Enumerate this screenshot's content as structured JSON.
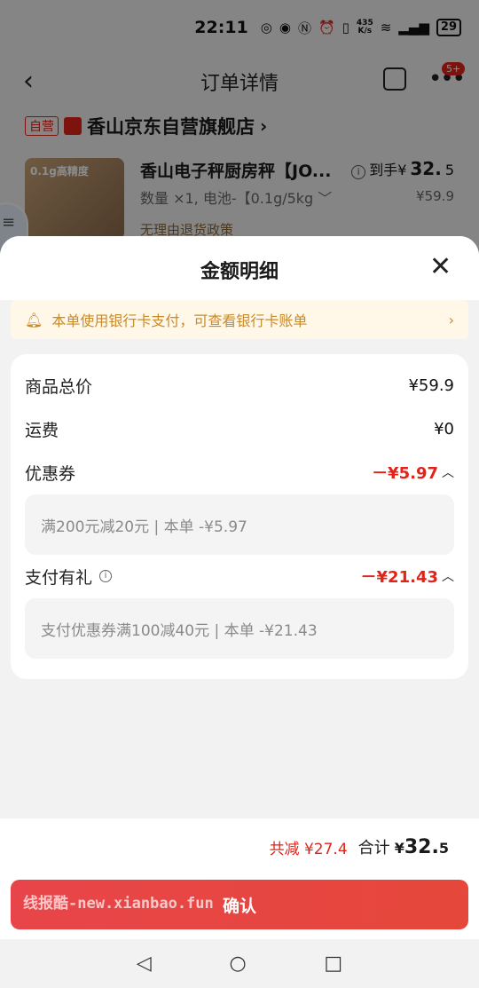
{
  "status_bar": {
    "time": "22:11",
    "net_speed_top": "435",
    "net_speed_bottom": "K/s",
    "battery": "29"
  },
  "nav": {
    "title": "订单详情",
    "badge": "5+"
  },
  "shop": {
    "tag": "自营",
    "name": "香山京东自营旗舰店",
    "arrow": "›"
  },
  "product": {
    "image_text": "0.1g高精度",
    "title": "香山电子秤厨房秤【JO...",
    "spec": "数量 ×1, 电池-【0.1g/5kg ﹀",
    "policy": "无理由退货政策",
    "price_prefix": "到手¥",
    "price_main": "32.",
    "price_decimal": "5",
    "original_price": "¥59.9"
  },
  "sheet": {
    "title": "金额明细",
    "notice": "本单使用银行卡支付，可查看银行卡账单",
    "rows": {
      "goods_total": {
        "label": "商品总价",
        "value": "¥59.9"
      },
      "shipping": {
        "label": "运费",
        "value": "¥0"
      },
      "coupon": {
        "label": "优惠券",
        "value": "－¥5.97",
        "detail": "满200元减20元 | 本单 -¥5.97"
      },
      "pay_gift": {
        "label": "支付有礼",
        "value": "－¥21.43",
        "detail": "支付优惠券满100减40元 | 本单 -¥21.43"
      }
    },
    "total": {
      "saved": "共减 ¥27.4",
      "label": "合计",
      "currency": "¥",
      "main": "32.",
      "decimal": "5"
    },
    "confirm_label": "确认",
    "watermark": "线报酷-new.xianbao.fun"
  },
  "colors": {
    "accent_red": "#e2231a",
    "notice_text": "#c98a2b",
    "notice_bg": "#fff7e8"
  },
  "icons": [
    "back-icon",
    "share-icon",
    "more-icon",
    "bell-icon",
    "close-icon",
    "info-icon",
    "chevron-up-icon",
    "home-icon",
    "back-triangle-icon",
    "recents-icon"
  ]
}
